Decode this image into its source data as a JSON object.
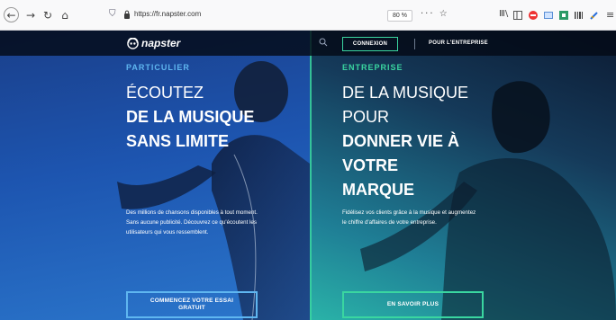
{
  "browser": {
    "url": "https://fr.napster.com",
    "zoom": "80 %",
    "page_actions": "··· ☆"
  },
  "site": {
    "logo_text": "napster",
    "nav": {
      "connexion": "CONNEXION",
      "entreprise": "POUR L'ENTREPRISE"
    }
  },
  "left": {
    "eyebrow": "PARTICULIER",
    "headline": [
      "ÉCOUTEZ",
      "DE LA MUSIQUE",
      "SANS LIMITE"
    ],
    "body": "Des millions de chansons disponibles à tout moment. Sans aucune publicité. Découvrez ce qu'écoutent les utilisateurs qui vous ressemblent.",
    "cta": "COMMENCEZ VOTRE ESSAI GRATUIT"
  },
  "right": {
    "eyebrow": "ENTREPRISE",
    "headline": [
      "DE LA MUSIQUE",
      "POUR",
      "DONNER VIE À",
      "VOTRE",
      "MARQUE"
    ],
    "body": "Fidélisez vos clients grâce à la musique et augmentez le chiffre d'affaires de votre entreprise.",
    "cta": "EN SAVOIR PLUS"
  },
  "colors": {
    "accent_blue": "#5fb6f0",
    "accent_green": "#3ad6a0",
    "left_bg": "#1d55b0",
    "right_bg": "#1f7f96"
  }
}
